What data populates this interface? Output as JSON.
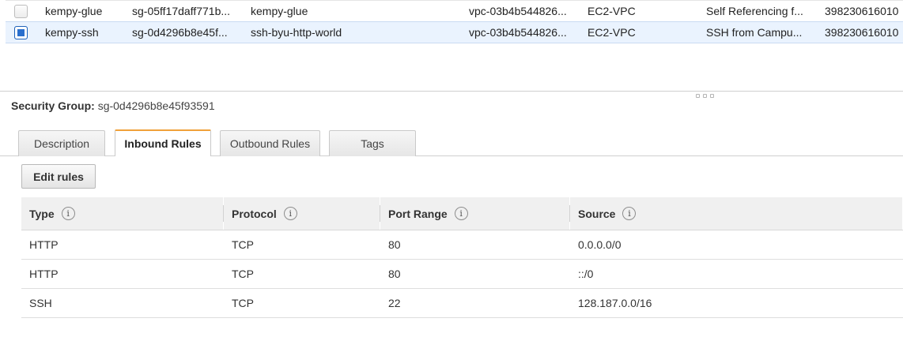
{
  "security_groups": [
    {
      "selected": false,
      "name": "kempy-glue",
      "group_id": "sg-05ff17daff771b...",
      "group_name": "kempy-glue",
      "vpc_id": "vpc-03b4b544826...",
      "platform": "EC2-VPC",
      "description": "Self Referencing f...",
      "owner": "398230616010"
    },
    {
      "selected": true,
      "name": "kempy-ssh",
      "group_id": "sg-0d4296b8e45f...",
      "group_name": "ssh-byu-http-world",
      "vpc_id": "vpc-03b4b544826...",
      "platform": "EC2-VPC",
      "description": "SSH from Campu...",
      "owner": "398230616010"
    }
  ],
  "detail": {
    "label": "Security Group:",
    "value": "sg-0d4296b8e45f93591"
  },
  "tabs": [
    {
      "label": "Description",
      "active": false
    },
    {
      "label": "Inbound Rules",
      "active": true
    },
    {
      "label": "Outbound Rules",
      "active": false
    },
    {
      "label": "Tags",
      "active": false
    }
  ],
  "edit_rules_label": "Edit rules",
  "info_glyph": "i",
  "rules_table": {
    "columns": [
      "Type",
      "Protocol",
      "Port Range",
      "Source"
    ],
    "rows": [
      [
        "HTTP",
        "TCP",
        "80",
        "0.0.0.0/0"
      ],
      [
        "HTTP",
        "TCP",
        "80",
        "::/0"
      ],
      [
        "SSH",
        "TCP",
        "22",
        "128.187.0.0/16"
      ]
    ]
  },
  "colors": {
    "selected_row": "#eaf3fe",
    "active_tab_accent": "#f0a13a",
    "checkbox_checked": "#2a6fcd"
  }
}
